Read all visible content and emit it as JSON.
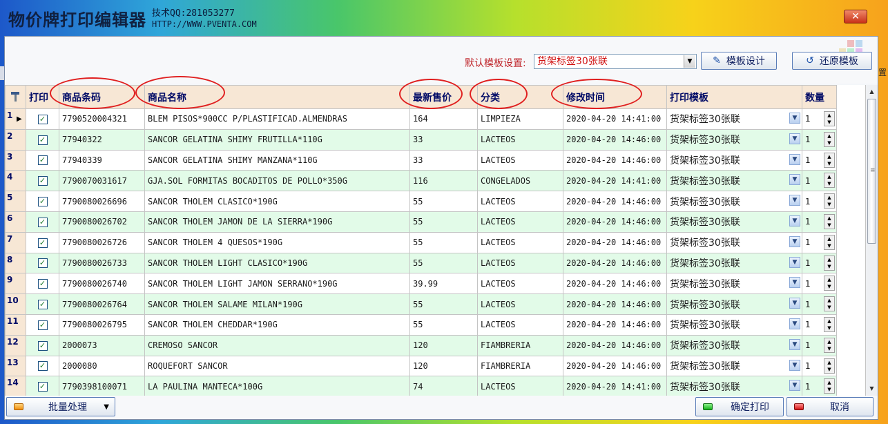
{
  "window": {
    "title": "物价牌打印编辑器",
    "tech_qq": "技术QQ:281053277",
    "website": "HTTP://WWW.PVENTA.COM",
    "close_label": "✕"
  },
  "toolbar": {
    "template_label": "默认模板设置:",
    "template_value": "货架标签30张联",
    "design_button": "模板设计",
    "restore_button": "还原模板"
  },
  "grid": {
    "columns": [
      "",
      "打印",
      "商品条码",
      "商品名称",
      "最新售价",
      "分类",
      "修改时间",
      "打印模板",
      "数量"
    ],
    "rows": [
      {
        "idx": "1",
        "checked": true,
        "barcode": "7790520004321",
        "name": "BLEM PISOS*900CC P/PLASTIFICAD.ALMENDRAS",
        "price": "164",
        "category": "LIMPIEZA",
        "modified": "2020-04-20 14:41:00",
        "template": "货架标签30张联",
        "qty": "1"
      },
      {
        "idx": "2",
        "checked": true,
        "barcode": "77940322",
        "name": "SANCOR GELATINA SHIMY FRUTILLA*110G",
        "price": "33",
        "category": "LACTEOS",
        "modified": "2020-04-20 14:46:00",
        "template": "货架标签30张联",
        "qty": "1"
      },
      {
        "idx": "3",
        "checked": true,
        "barcode": "77940339",
        "name": "SANCOR GELATINA SHIMY MANZANA*110G",
        "price": "33",
        "category": "LACTEOS",
        "modified": "2020-04-20 14:46:00",
        "template": "货架标签30张联",
        "qty": "1"
      },
      {
        "idx": "4",
        "checked": true,
        "barcode": "7790070031617",
        "name": "GJA.SOL FORMITAS BOCADITOS DE POLLO*350G",
        "price": "116",
        "category": "CONGELADOS",
        "modified": "2020-04-20 14:41:00",
        "template": "货架标签30张联",
        "qty": "1"
      },
      {
        "idx": "5",
        "checked": true,
        "barcode": "7790080026696",
        "name": "SANCOR THOLEM CLASICO*190G",
        "price": "55",
        "category": "LACTEOS",
        "modified": "2020-04-20 14:46:00",
        "template": "货架标签30张联",
        "qty": "1"
      },
      {
        "idx": "6",
        "checked": true,
        "barcode": "7790080026702",
        "name": "SANCOR THOLEM JAMON DE LA SIERRA*190G",
        "price": "55",
        "category": "LACTEOS",
        "modified": "2020-04-20 14:46:00",
        "template": "货架标签30张联",
        "qty": "1"
      },
      {
        "idx": "7",
        "checked": true,
        "barcode": "7790080026726",
        "name": "SANCOR THOLEM 4 QUESOS*190G",
        "price": "55",
        "category": "LACTEOS",
        "modified": "2020-04-20 14:46:00",
        "template": "货架标签30张联",
        "qty": "1"
      },
      {
        "idx": "8",
        "checked": true,
        "barcode": "7790080026733",
        "name": "SANCOR THOLEM LIGHT CLASICO*190G",
        "price": "55",
        "category": "LACTEOS",
        "modified": "2020-04-20 14:46:00",
        "template": "货架标签30张联",
        "qty": "1"
      },
      {
        "idx": "9",
        "checked": true,
        "barcode": "7790080026740",
        "name": "SANCOR THOLEM LIGHT JAMON SERRANO*190G",
        "price": "39.99",
        "category": "LACTEOS",
        "modified": "2020-04-20 14:46:00",
        "template": "货架标签30张联",
        "qty": "1"
      },
      {
        "idx": "10",
        "checked": true,
        "barcode": "7790080026764",
        "name": "SANCOR THOLEM SALAME MILAN*190G",
        "price": "55",
        "category": "LACTEOS",
        "modified": "2020-04-20 14:46:00",
        "template": "货架标签30张联",
        "qty": "1"
      },
      {
        "idx": "11",
        "checked": true,
        "barcode": "7790080026795",
        "name": "SANCOR THOLEM CHEDDAR*190G",
        "price": "55",
        "category": "LACTEOS",
        "modified": "2020-04-20 14:46:00",
        "template": "货架标签30张联",
        "qty": "1"
      },
      {
        "idx": "12",
        "checked": true,
        "barcode": "2000073",
        "name": "CREMOSO SANCOR",
        "price": "120",
        "category": "FIAMBRERIA",
        "modified": "2020-04-20 14:46:00",
        "template": "货架标签30张联",
        "qty": "1"
      },
      {
        "idx": "13",
        "checked": true,
        "barcode": "2000080",
        "name": "ROQUEFORT SANCOR",
        "price": "120",
        "category": "FIAMBRERIA",
        "modified": "2020-04-20 14:46:00",
        "template": "货架标签30张联",
        "qty": "1"
      },
      {
        "idx": "14",
        "checked": true,
        "barcode": "7790398100071",
        "name": "LA PAULINA MANTECA*100G",
        "price": "74",
        "category": "LACTEOS",
        "modified": "2020-04-20 14:41:00",
        "template": "货架标签30张联",
        "qty": "1"
      }
    ]
  },
  "footer": {
    "batch_button": "批量处理",
    "print_button": "确定打印",
    "cancel_button": "取消"
  },
  "side_stub": "置",
  "colors": {
    "header_bg": "#f7e7d5",
    "row_alt": "#e2fbe8",
    "annotation": "#e02020",
    "template_text": "#d01010"
  }
}
